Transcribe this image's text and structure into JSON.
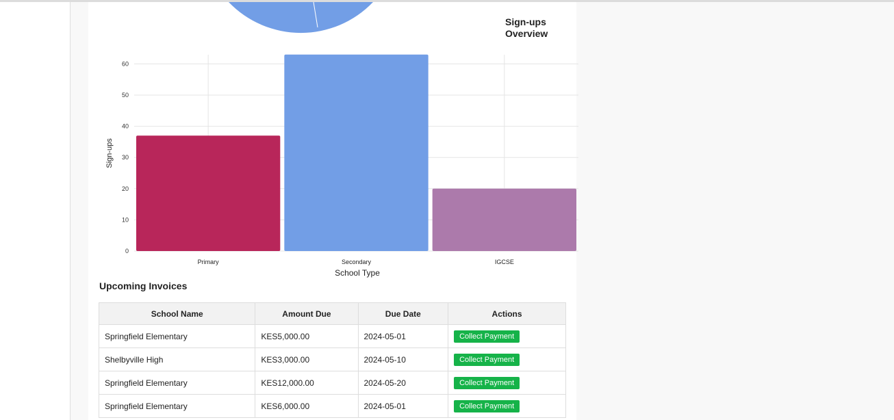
{
  "pie_chart": {
    "title": "Sign-ups Overview",
    "slice_color": "#729ee6"
  },
  "chart_data": {
    "type": "bar",
    "categories": [
      "Primary",
      "Secondary",
      "IGCSE"
    ],
    "values": [
      37,
      63,
      20
    ],
    "colors": [
      "#b8265a",
      "#729ee6",
      "#ac7aab"
    ],
    "xlabel": "School Type",
    "ylabel": "Sign-ups",
    "ylim": [
      0,
      65
    ],
    "yticks": [
      0,
      10,
      20,
      30,
      40,
      50,
      60
    ],
    "grid": true
  },
  "invoices": {
    "title": "Upcoming Invoices",
    "columns": [
      "School Name",
      "Amount Due",
      "Due Date",
      "Actions"
    ],
    "action_label": "Collect Payment",
    "rows": [
      {
        "school": "Springfield Elementary",
        "amount": "KES5,000.00",
        "date": "2024-05-01"
      },
      {
        "school": "Shelbyville High",
        "amount": "KES3,000.00",
        "date": "2024-05-10"
      },
      {
        "school": "Springfield Elementary",
        "amount": "KES12,000.00",
        "date": "2024-05-20"
      },
      {
        "school": "Springfield Elementary",
        "amount": "KES6,000.00",
        "date": "2024-05-01"
      }
    ]
  }
}
